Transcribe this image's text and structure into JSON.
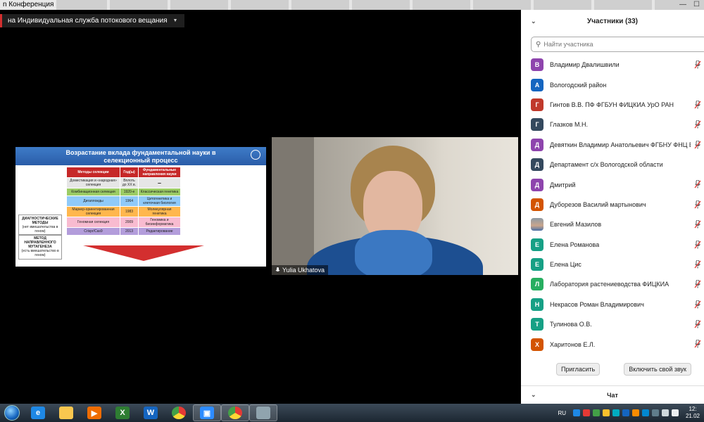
{
  "window": {
    "title": "n Конференция"
  },
  "share_bar": {
    "label": "на Индивидуальная служба потокового вещания"
  },
  "slide": {
    "title_line1": "Возрастание вклада фундаментальной науки в",
    "title_line2": "селекционный процесс",
    "headers": [
      "Методы селекции",
      "Год(ы)",
      "Фундаментальные направления науки"
    ],
    "rows": [
      [
        "Доместикация и «народная» селекция",
        "Вплоть до XX в.",
        "–"
      ],
      [
        "Комбинационная селекция",
        "1920-е",
        "Классическая генетика"
      ],
      [
        "Дигаплоиды",
        "1964",
        "Цитогенетика и клеточная биология"
      ],
      [
        "Маркер-ориентированная селекция",
        "1983",
        "Молекулярная генетика"
      ],
      [
        "Геномная селекция",
        "2009",
        "Геномика и биоинформатика"
      ],
      [
        "Crispr/Cas9",
        "2013",
        "Редактирование"
      ]
    ],
    "box1_title": "ДИАГНОСТИЧЕСКИЕ МЕТОДЫ",
    "box1_note": "(нет вмешательства в геном)",
    "box2_title": "МЕТОД НАПРАВЛЕННОГО МУТАГЕНЕЗА",
    "box2_note": "(есть вмешательство в геном)"
  },
  "video": {
    "participant_name": "Yulia Ukhatova"
  },
  "participants": {
    "title": "Участники (33)",
    "search_placeholder": "Найти участника",
    "items": [
      {
        "initial": "В",
        "name": "Владимир Двалишвили",
        "color": "#8e44ad",
        "muted": true
      },
      {
        "initial": "А",
        "name": "Вологодский район",
        "color": "#1565c0",
        "muted": false
      },
      {
        "initial": "Г",
        "name": "Гинтов В.В.  ПФ ФГБУН ФИЦКИА УрО РАН",
        "color": "#c0392b",
        "muted": true
      },
      {
        "initial": "Г",
        "name": "Глазков М.Н.",
        "color": "#34495e",
        "muted": true
      },
      {
        "initial": "Д",
        "name": "Девяткин Владимир Анатольевич ФГБНУ ФНЦ ВИ...",
        "color": "#8e44ad",
        "muted": true
      },
      {
        "initial": "Д",
        "name": "Департамент с/х Вологодской области",
        "color": "#34495e",
        "muted": false
      },
      {
        "initial": "Д",
        "name": "Дмитрий",
        "color": "#8e44ad",
        "muted": true
      },
      {
        "initial": "Д",
        "name": "Дуборезов Василий мартынович",
        "color": "#d35400",
        "muted": true
      },
      {
        "initial": "",
        "name": "Евгений Мазилов",
        "color": "#7f8c8d",
        "muted": true
      },
      {
        "initial": "Е",
        "name": "Елена Романова",
        "color": "#16a085",
        "muted": true
      },
      {
        "initial": "Е",
        "name": "Елена Цис",
        "color": "#16a085",
        "muted": true
      },
      {
        "initial": "Л",
        "name": "Лаборатория растениеводства ФИЦКИА",
        "color": "#27ae60",
        "muted": true
      },
      {
        "initial": "Н",
        "name": "Некрасов Роман Владимирович",
        "color": "#16a085",
        "muted": true
      },
      {
        "initial": "Т",
        "name": "Тулинова О.В.",
        "color": "#16a085",
        "muted": true
      },
      {
        "initial": "Х",
        "name": "Харитонов Е.Л.",
        "color": "#d35400",
        "muted": true
      }
    ],
    "invite_label": "Пригласить",
    "unmute_label": "Включить свой звук"
  },
  "chat": {
    "title": "Чат"
  },
  "taskbar": {
    "lang": "RU",
    "time": "12:",
    "date": "21.02"
  }
}
